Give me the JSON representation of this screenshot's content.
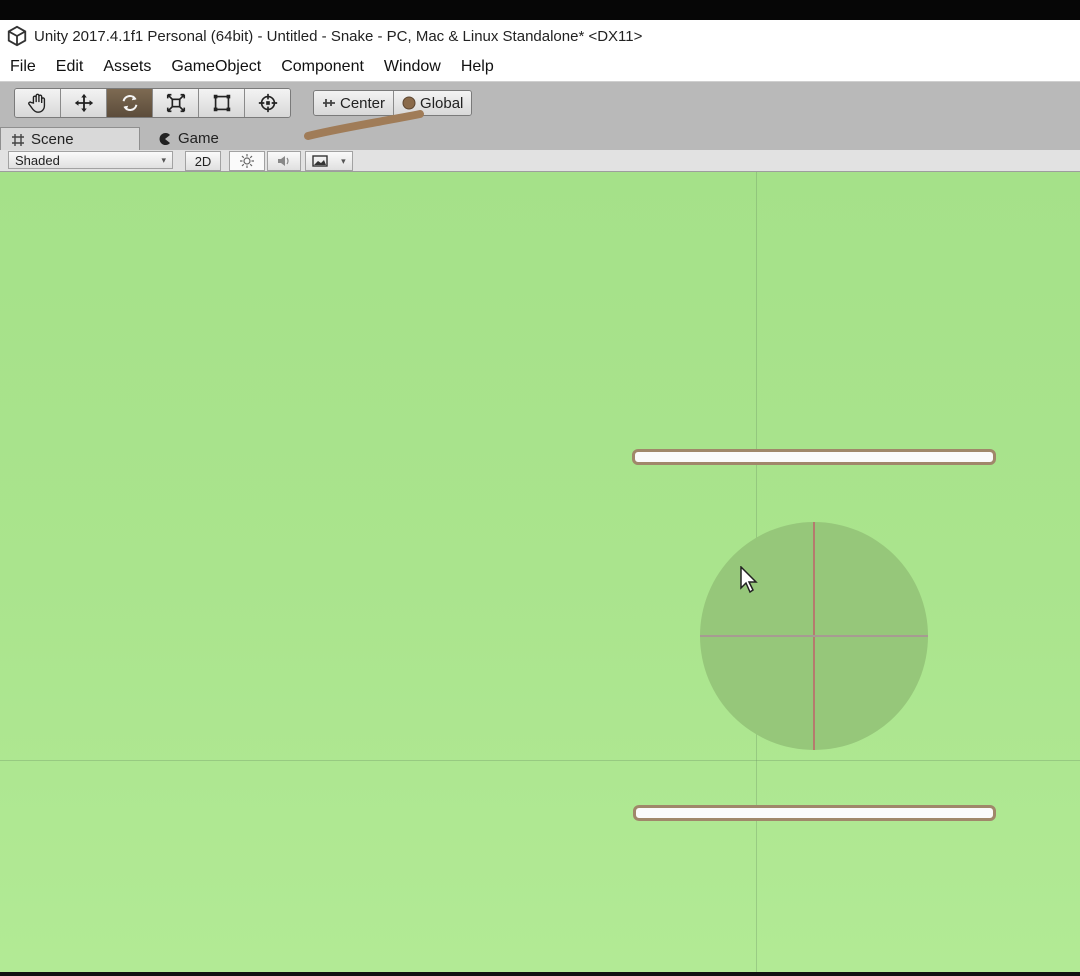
{
  "window": {
    "title": "Unity 2017.4.1f1 Personal (64bit) - Untitled - Snake - PC, Mac & Linux Standalone* <DX11>"
  },
  "menu": [
    "File",
    "Edit",
    "Assets",
    "GameObject",
    "Component",
    "Window",
    "Help"
  ],
  "toolbar": {
    "tools": [
      "hand-tool",
      "move-tool",
      "rotate-tool",
      "scale-tool",
      "rect-tool",
      "transform-tool"
    ],
    "active_tool": "rotate-tool",
    "pivot_label": "Center",
    "space_label": "Global"
  },
  "tabs": {
    "scene": "Scene",
    "game": "Game",
    "active": "Scene"
  },
  "scene_toolbar": {
    "shading_mode": "Shaded",
    "mode_2d": "2D"
  },
  "scene_view": {
    "background_color": "#a9e38c",
    "objects": [
      "top-paddle",
      "ball",
      "bottom-paddle"
    ]
  }
}
